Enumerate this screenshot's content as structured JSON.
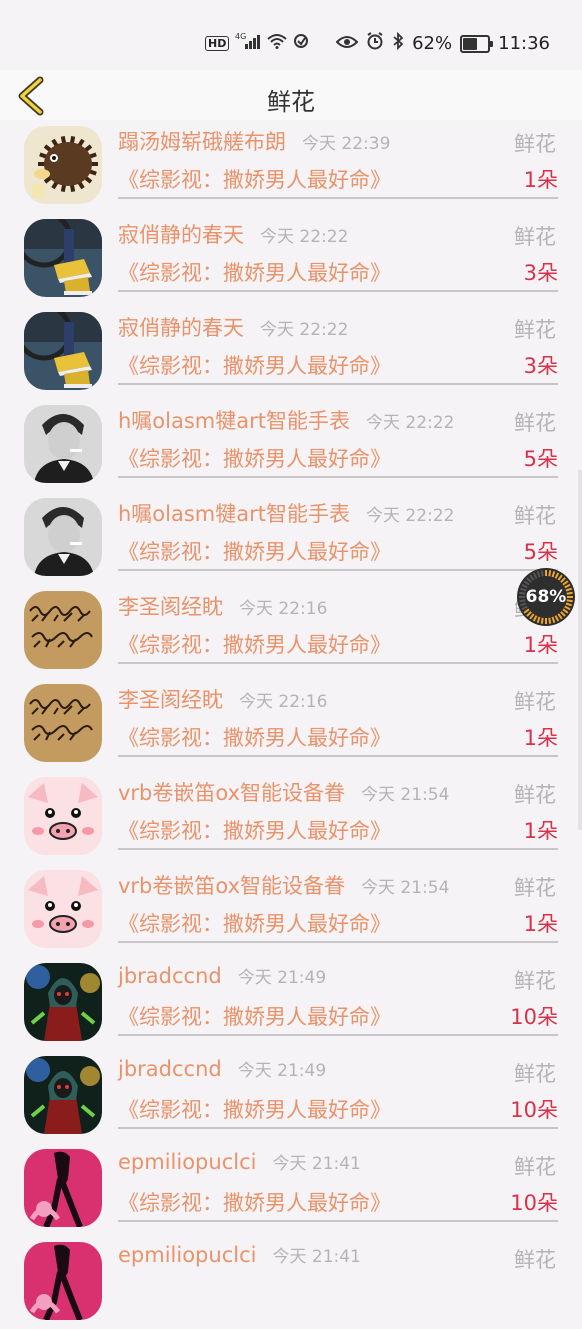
{
  "status_bar": {
    "hd": "HD",
    "network": "4G",
    "battery_percent": "62%",
    "battery_level": 0.62,
    "time": "11:36",
    "icons": [
      "signal-icon",
      "wifi-icon",
      "sync-icon",
      "eye-icon",
      "alarm-icon",
      "bluetooth-icon",
      "battery-icon"
    ]
  },
  "header": {
    "title": "鲜花",
    "back_icon": "chevron-left-icon"
  },
  "floating_badge": {
    "text": "68%",
    "level": 0.68
  },
  "items": [
    {
      "user": "蹋汤姆崭硪艖布朗",
      "time": "今天 22:39",
      "gift": "鲜花",
      "work": "《综影视：撒娇男人最好命》",
      "count": "1朵",
      "avatar": "hedgehog"
    },
    {
      "user": "寂俏静的春天",
      "time": "今天 22:22",
      "gift": "鲜花",
      "work": "《综影视：撒娇男人最好命》",
      "count": "3朵",
      "avatar": "sneakers"
    },
    {
      "user": "寂俏静的春天",
      "time": "今天 22:22",
      "gift": "鲜花",
      "work": "《综影视：撒娇男人最好命》",
      "count": "3朵",
      "avatar": "sneakers"
    },
    {
      "user": "h嘱olasm犍art智能手表",
      "time": "今天 22:22",
      "gift": "鲜花",
      "work": "《综影视：撒娇男人最好命》",
      "count": "5朵",
      "avatar": "man"
    },
    {
      "user": "h嘱olasm犍art智能手表",
      "time": "今天 22:22",
      "gift": "鲜花",
      "work": "《综影视：撒娇男人最好命》",
      "count": "5朵",
      "avatar": "man"
    },
    {
      "user": "李圣阂经眈",
      "time": "今天 22:16",
      "gift": "鲜花",
      "work": "《综影视：撒娇男人最好命》",
      "count": "1朵",
      "avatar": "calligraphy"
    },
    {
      "user": "李圣阂经眈",
      "time": "今天 22:16",
      "gift": "鲜花",
      "work": "《综影视：撒娇男人最好命》",
      "count": "1朵",
      "avatar": "calligraphy"
    },
    {
      "user": "vrb卷嵌笛ox智能设备眷",
      "time": "今天 21:54",
      "gift": "鲜花",
      "work": "《综影视：撒娇男人最好命》",
      "count": "1朵",
      "avatar": "pig"
    },
    {
      "user": "vrb卷嵌笛ox智能设备眷",
      "time": "今天 21:54",
      "gift": "鲜花",
      "work": "《综影视：撒娇男人最好命》",
      "count": "1朵",
      "avatar": "pig"
    },
    {
      "user": "jbradccnd",
      "time": "今天 21:49",
      "gift": "鲜花",
      "work": "《综影视：撒娇男人最好命》",
      "count": "10朵",
      "avatar": "warrior"
    },
    {
      "user": "jbradccnd",
      "time": "今天 21:49",
      "gift": "鲜花",
      "work": "《综影视：撒娇男人最好命》",
      "count": "10朵",
      "avatar": "warrior"
    },
    {
      "user": "epmiliopuclci",
      "time": "今天 21:41",
      "gift": "鲜花",
      "work": "《综影视：撒娇男人最好命》",
      "count": "10朵",
      "avatar": "pinkpanther"
    },
    {
      "user": "epmiliopuclci",
      "time": "今天 21:41",
      "gift": "鲜花",
      "work": "",
      "count": "",
      "avatar": "pinkpanther"
    }
  ]
}
